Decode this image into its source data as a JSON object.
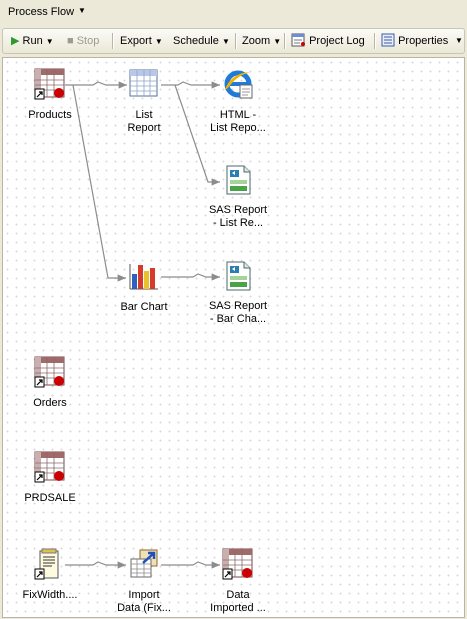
{
  "title": "Process Flow",
  "toolbar": {
    "run": "Run",
    "stop": "Stop",
    "export": "Export",
    "schedule": "Schedule",
    "zoom": "Zoom",
    "project_log": "Project Log",
    "properties": "Properties"
  },
  "nodes": {
    "products": "Products",
    "list_report": "List\nReport",
    "html_list": "HTML -\nList Repo...",
    "sas_list": "SAS Report\n- List Re...",
    "bar_chart": "Bar Chart",
    "sas_bar": "SAS Report\n- Bar Cha...",
    "orders": "Orders",
    "prdsale": "PRDSALE",
    "fixwidth": "FixWidth....",
    "import": "Import\nData (Fix...",
    "data_imported": "Data\nImported ..."
  },
  "colors": {
    "accent_green": "#2e9a2e",
    "table_red": "#cc0000",
    "link_gray": "#8c8c8c"
  }
}
